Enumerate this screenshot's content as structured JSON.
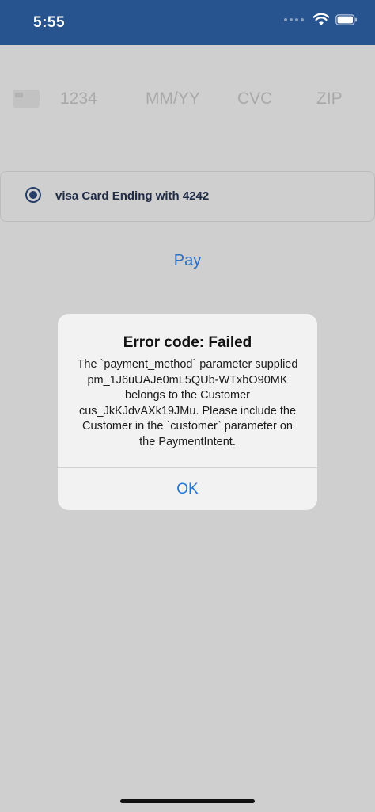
{
  "status_bar": {
    "time": "5:55",
    "icons": [
      "signal-dots-icon",
      "wifi-icon",
      "battery-icon"
    ]
  },
  "card_form": {
    "number_placeholder": "1234",
    "expiry_placeholder": "MM/YY",
    "cvc_placeholder": "CVC",
    "zip_placeholder": "ZIP"
  },
  "saved_card": {
    "label": "visa Card Ending with 4242",
    "selected": true
  },
  "pay": {
    "label": "Pay"
  },
  "alert": {
    "title": "Error code: Failed",
    "message": "The `payment_method` parameter supplied pm_1J6uUAJe0mL5QUb-WTxbO90MK belongs to the Customer cus_JkKJdvAXk19JMu. Please include the Customer in the `customer` parameter on the PaymentIntent.",
    "ok_label": "OK"
  },
  "colors": {
    "status_bar": "#27548f",
    "overlay_background": "#cfcfcf",
    "accent": "#2176d6"
  }
}
